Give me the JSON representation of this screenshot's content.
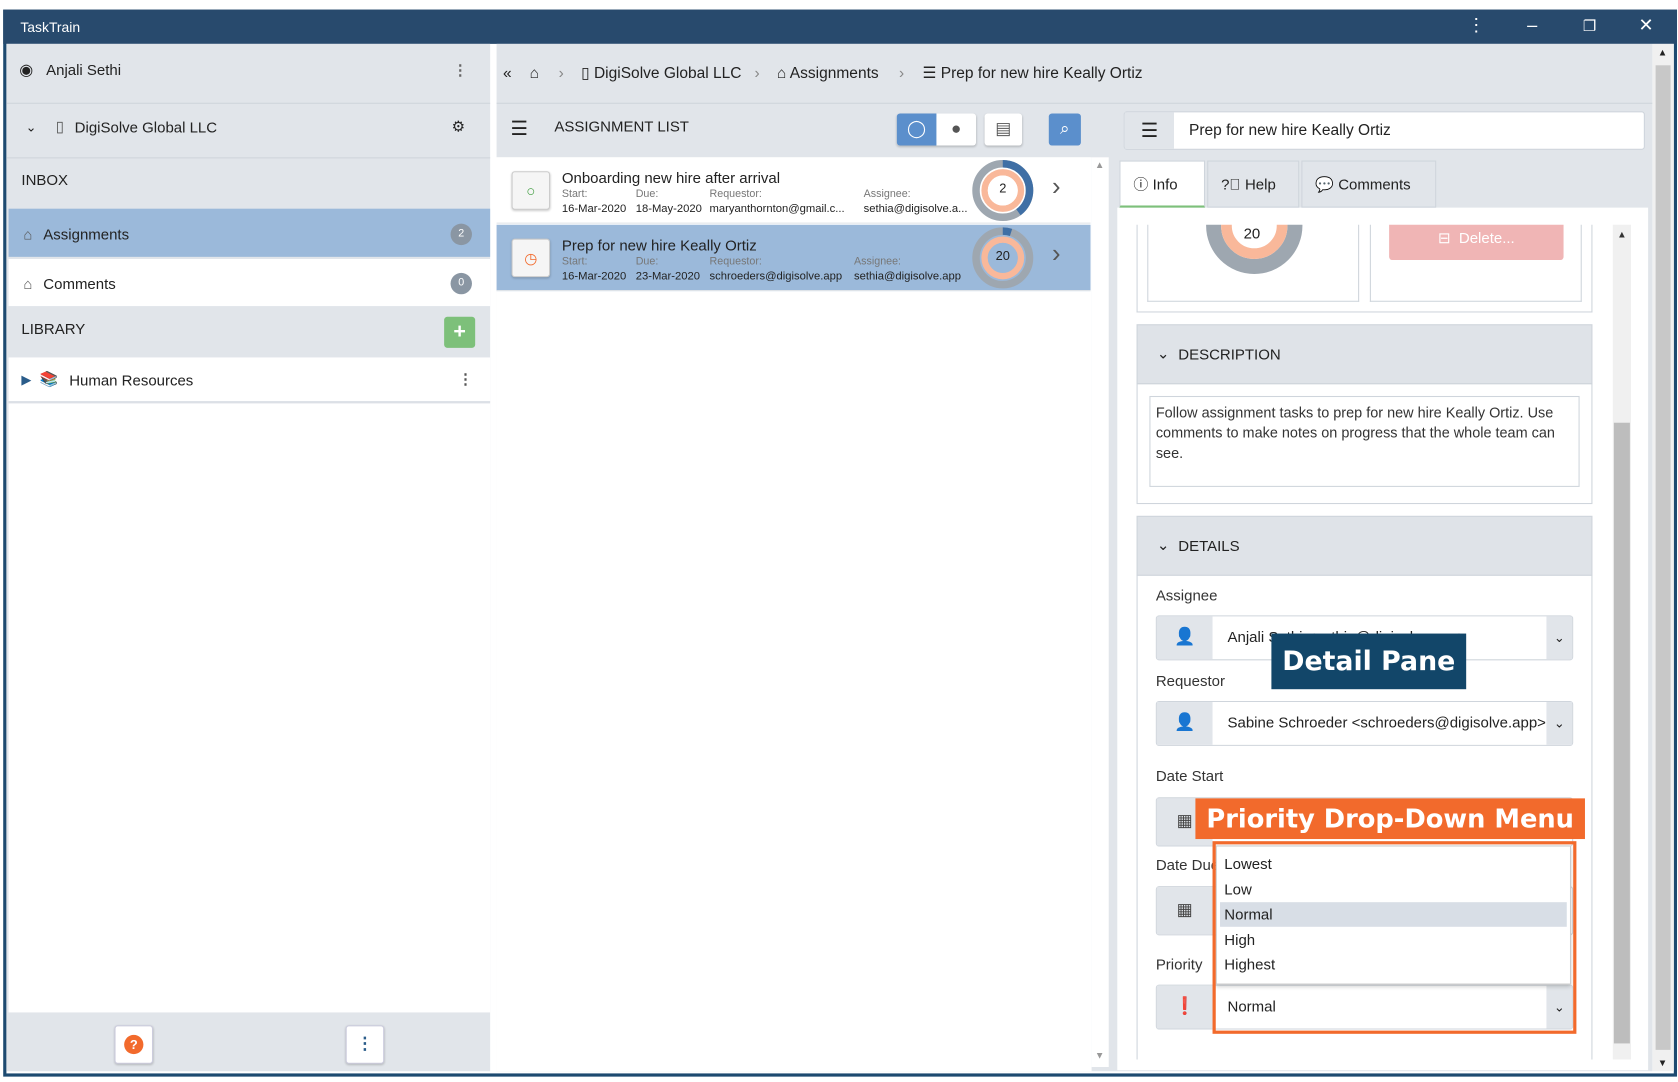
{
  "window": {
    "title": "TaskTrain"
  },
  "sidebar": {
    "user": "Anjali Sethi",
    "org": "DigiSolve Global LLC",
    "inbox_label": "INBOX",
    "items": [
      {
        "label": "Assignments",
        "count": "2"
      },
      {
        "label": "Comments",
        "count": "0"
      }
    ],
    "library_label": "LIBRARY",
    "library_items": [
      {
        "label": "Human Resources"
      }
    ],
    "help_icon": "?"
  },
  "breadcrumb": [
    "DigiSolve Global LLC",
    "Assignments",
    "Prep for new hire Keally Ortiz"
  ],
  "list": {
    "title": "ASSIGNMENT LIST",
    "labels": {
      "start": "Start:",
      "due": "Due:",
      "requestor": "Requestor:",
      "assignee": "Assignee:"
    },
    "items": [
      {
        "title": "Onboarding new hire after arrival",
        "start": "16-Mar-2020",
        "due": "18-May-2020",
        "requestor": "maryanthornton@gmail.c...",
        "assignee": "sethia@digisolve.a...",
        "count": "2",
        "progress": 0.4,
        "status": "open"
      },
      {
        "title": "Prep for new hire Keally Ortiz",
        "start": "16-Mar-2020",
        "due": "23-Mar-2020",
        "requestor": "schroeders@digisolve.app",
        "assignee": "sethia@digisolve.app",
        "count": "20",
        "progress": 0.05,
        "status": "pending"
      }
    ]
  },
  "detail": {
    "title": "Prep for new hire Keally Ortiz",
    "tabs": [
      "Info",
      "Help",
      "Comments"
    ],
    "donut_count": "20",
    "delete_label": "Delete...",
    "description_header": "DESCRIPTION",
    "description": "Follow assignment tasks to prep for new hire Keally Ortiz. Use comments to make notes on progress that the whole team can see.",
    "details_header": "DETAILS",
    "assignee_label": "Assignee",
    "assignee": "Anjali Sethi <sethia@digisolve.app>",
    "requestor_label": "Requestor",
    "requestor": "Sabine Schroeder <schroeders@digisolve.app>",
    "date_start_label": "Date Start",
    "date_due_label": "Date Due",
    "priority_label": "Priority",
    "priority": "Normal",
    "priority_options": [
      "Lowest",
      "Low",
      "Normal",
      "High",
      "Highest"
    ]
  },
  "annotations": {
    "detail_pane": "Detail Pane",
    "priority_menu": "Priority Drop-Down Menu"
  },
  "colors": {
    "titlebar": "#284a6d",
    "selected": "#9bb9da",
    "accent": "#5b8fcc",
    "annotation_blue": "#124669",
    "annotation_orange": "#f26a2c"
  }
}
